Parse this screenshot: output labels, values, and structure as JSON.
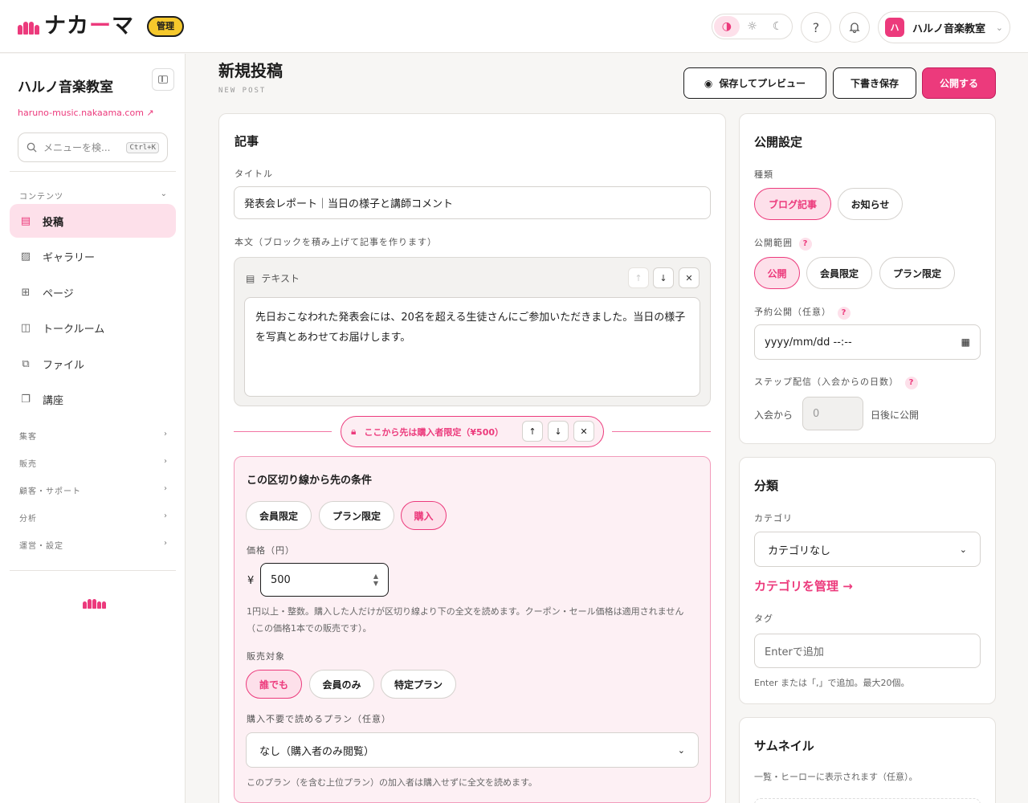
{
  "header": {
    "logo_prefix": "ナカ",
    "logo_accent": "ー",
    "logo_suffix": "マ",
    "admin_badge": "管理",
    "theme_icons": [
      "contrast-icon",
      "sun-icon",
      "moon-icon"
    ],
    "account_avatar": "ハ",
    "account_name": "ハルノ音楽教室"
  },
  "sidebar": {
    "school_name": "ハルノ音楽教室",
    "site_link": "haruno-music.nakaama.com",
    "search_placeholder": "メニューを検...",
    "search_shortcut": "Ctrl+K",
    "content_section": "コンテンツ",
    "items": [
      {
        "label": "投稿",
        "icon": "document-icon",
        "active": true
      },
      {
        "label": "ギャラリー",
        "icon": "image-icon",
        "active": false
      },
      {
        "label": "ページ",
        "icon": "pages-icon",
        "active": false
      },
      {
        "label": "トークルーム",
        "icon": "chat-icon",
        "active": false
      },
      {
        "label": "ファイル",
        "icon": "file-icon",
        "active": false
      },
      {
        "label": "講座",
        "icon": "book-icon",
        "active": false
      }
    ],
    "sections": [
      "集客",
      "販売",
      "顧客・サポート",
      "分析",
      "運営・設定"
    ]
  },
  "page": {
    "title": "新規投稿",
    "subtitle": "NEW POST",
    "preview_button": "保存してプレビュー",
    "draft_button": "下書き保存",
    "publish_button": "公開する"
  },
  "article": {
    "card_title": "記事",
    "title_label": "タイトル",
    "title_value": "発表会レポート｜当日の様子と講師コメント",
    "body_label": "本文（ブロックを積み上げて記事を作ります）",
    "block_type": "テキスト",
    "block_text": "先日おこなわれた発表会には、20名を超える生徒さんにご参加いただきました。当日の様子を写真とあわせてお届けします。",
    "paywall_label": "ここから先は購入者限定（¥500）",
    "conditions": {
      "title": "この区切り線から先の条件",
      "options": [
        "会員限定",
        "プラン限定",
        "購入"
      ],
      "selected": "購入",
      "price_label": "価格（円）",
      "currency": "¥",
      "price_value": "500",
      "price_help": "1円以上・整数。購入した人だけが区切り線より下の全文を読めます。クーポン・セール価格は適用されません（この価格1本での販売です）。",
      "target_label": "販売対象",
      "targets": [
        "誰でも",
        "会員のみ",
        "特定プラン"
      ],
      "target_selected": "誰でも",
      "free_plan_label": "購入不要で読めるプラン（任意）",
      "free_plan_value": "なし（購入者のみ閲覧）",
      "free_plan_help": "このプラン（を含む上位プラン）の加入者は購入せずに全文を読めます。"
    }
  },
  "publish": {
    "card_title": "公開設定",
    "type_label": "種類",
    "types": [
      "ブログ記事",
      "お知らせ"
    ],
    "type_selected": "ブログ記事",
    "scope_label": "公開範囲",
    "scopes": [
      "公開",
      "会員限定",
      "プラン限定"
    ],
    "scope_selected": "公開",
    "schedule_label": "予約公開（任意）",
    "schedule_placeholder": "yyyy/mm/dd --:--",
    "step_label": "ステップ配信（入会からの日数）",
    "step_prefix": "入会から",
    "step_value": "0",
    "step_suffix": "日後に公開"
  },
  "classification": {
    "card_title": "分類",
    "category_label": "カテゴリ",
    "category_value": "カテゴリなし",
    "manage_link": "カテゴリを管理 →",
    "tag_label": "タグ",
    "tag_placeholder": "Enterで追加",
    "tag_help": "Enter または「,」で追加。最大20個。"
  },
  "thumbnail": {
    "card_title": "サムネイル",
    "help": "一覧・ヒーローに表示されます（任意）。"
  },
  "colors": {
    "accent": "#ec3a7c",
    "badge": "#f5c82c"
  }
}
